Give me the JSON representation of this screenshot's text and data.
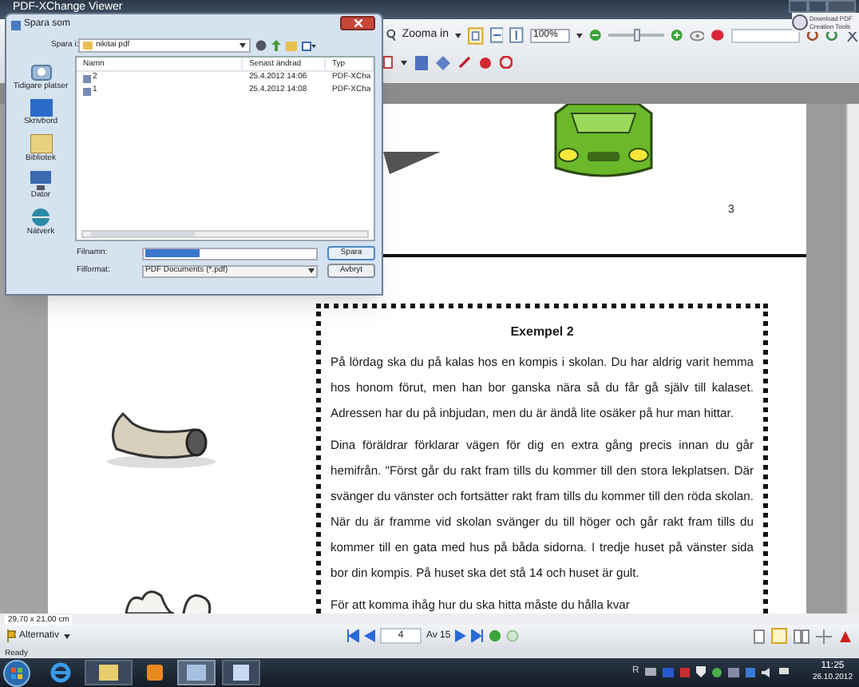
{
  "window": {
    "title": "PDF-XChange Viewer"
  },
  "promo": "Download PDF Creation Tools",
  "toolbar": {
    "zoom_in": "Zooma in",
    "zoom_value": "100%",
    "zoom_slider": {
      "level": 0.5
    }
  },
  "document": {
    "page_number": "3",
    "example": {
      "title": "Exempel 2",
      "paragraphs": [
        "På lördag ska du på kalas hos en kompis i skolan. Du har aldrig varit hemma hos honom förut, men han bor ganska nära så du får gå själv till kalaset. Adressen har du på inbjudan, men du är ändå lite osäker på hur man hittar.",
        "Dina föräldrar förklarar vägen för dig en extra gång precis innan du går hemifrån. \"Först går du rakt fram tills du kommer till den stora lekplatsen. Där svänger du vänster och fortsätter rakt fram tills du kommer till den röda skolan. När du är framme vid skolan svänger du till höger och går rakt fram tills du kommer till en gata med hus på båda sidorna. I tredje huset på vänster sida bor din kompis. På huset ska det stå 14 och huset är gult.",
        "För att komma ihåg hur du ska hitta måste du hålla kvar"
      ]
    }
  },
  "status": {
    "page_size": "29,70 x 21,00 cm",
    "options": "Alternativ",
    "page": "4",
    "page_count": "Av 15",
    "status_text": "Ready"
  },
  "taskbar": {
    "tray_letter": "R",
    "time": "11:25",
    "date": "26.10.2012"
  },
  "dialog": {
    "title": "Spara som",
    "location_label": "Spara i:",
    "location": "nikitai pdf",
    "places": [
      "Tidigare platser",
      "Skrivbord",
      "Bibliotek",
      "Dator",
      "Nätverk"
    ],
    "columns": [
      "Namn",
      "Senast ändrad",
      "Typ"
    ],
    "files": [
      {
        "name": "2",
        "modified": "25.4.2012 14:06",
        "type": "PDF-XCha"
      },
      {
        "name": "1",
        "modified": "25.4.2012 14:08",
        "type": "PDF-XCha"
      }
    ],
    "filename_label": "Filnamn:",
    "format_label": "Filformat:",
    "format": "PDF Documents (*.pdf)",
    "buttons": [
      "Spara",
      "Avbryt"
    ]
  }
}
